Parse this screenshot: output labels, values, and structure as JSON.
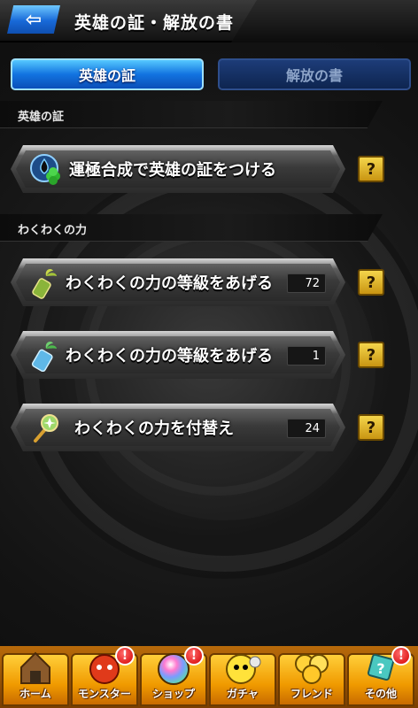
{
  "header": {
    "back_icon": "back-arrow-icon",
    "title": "英雄の証・解放の書"
  },
  "tabs": [
    {
      "label": "英雄の証",
      "active": true
    },
    {
      "label": "解放の書",
      "active": false
    }
  ],
  "sections": [
    {
      "label": "英雄の証",
      "items": [
        {
          "label": "運極合成で英雄の証をつける",
          "icon": "clover-drop-icon",
          "count": null
        }
      ]
    },
    {
      "label": "わくわくの力",
      "items": [
        {
          "label": "わくわくの力の等級をあげる",
          "icon": "sprout-bottle-small-icon",
          "count": "72"
        },
        {
          "label": "わくわくの力の等級をあげる",
          "icon": "sprout-bottle-large-icon",
          "count": "1"
        },
        {
          "label": "わくわくの力を付替え",
          "icon": "magic-wand-icon",
          "count": "24"
        }
      ]
    }
  ],
  "help_label": "?",
  "bottom_nav": [
    {
      "label": "ホーム",
      "icon": "home-icon",
      "badge": null
    },
    {
      "label": "モンスター",
      "icon": "monster-icon",
      "badge": "!"
    },
    {
      "label": "ショップ",
      "icon": "shop-orb-icon",
      "badge": "!"
    },
    {
      "label": "ガチャ",
      "icon": "gacha-icon",
      "badge": null
    },
    {
      "label": "フレンド",
      "icon": "friends-icon",
      "badge": null
    },
    {
      "label": "その他",
      "icon": "other-icon",
      "badge": "!"
    }
  ],
  "colors": {
    "tab_active": "#1273e0",
    "tab_inactive": "#0e2550",
    "help": "#f4d54b",
    "nav": "#f09a00",
    "badge": "#d40000"
  }
}
